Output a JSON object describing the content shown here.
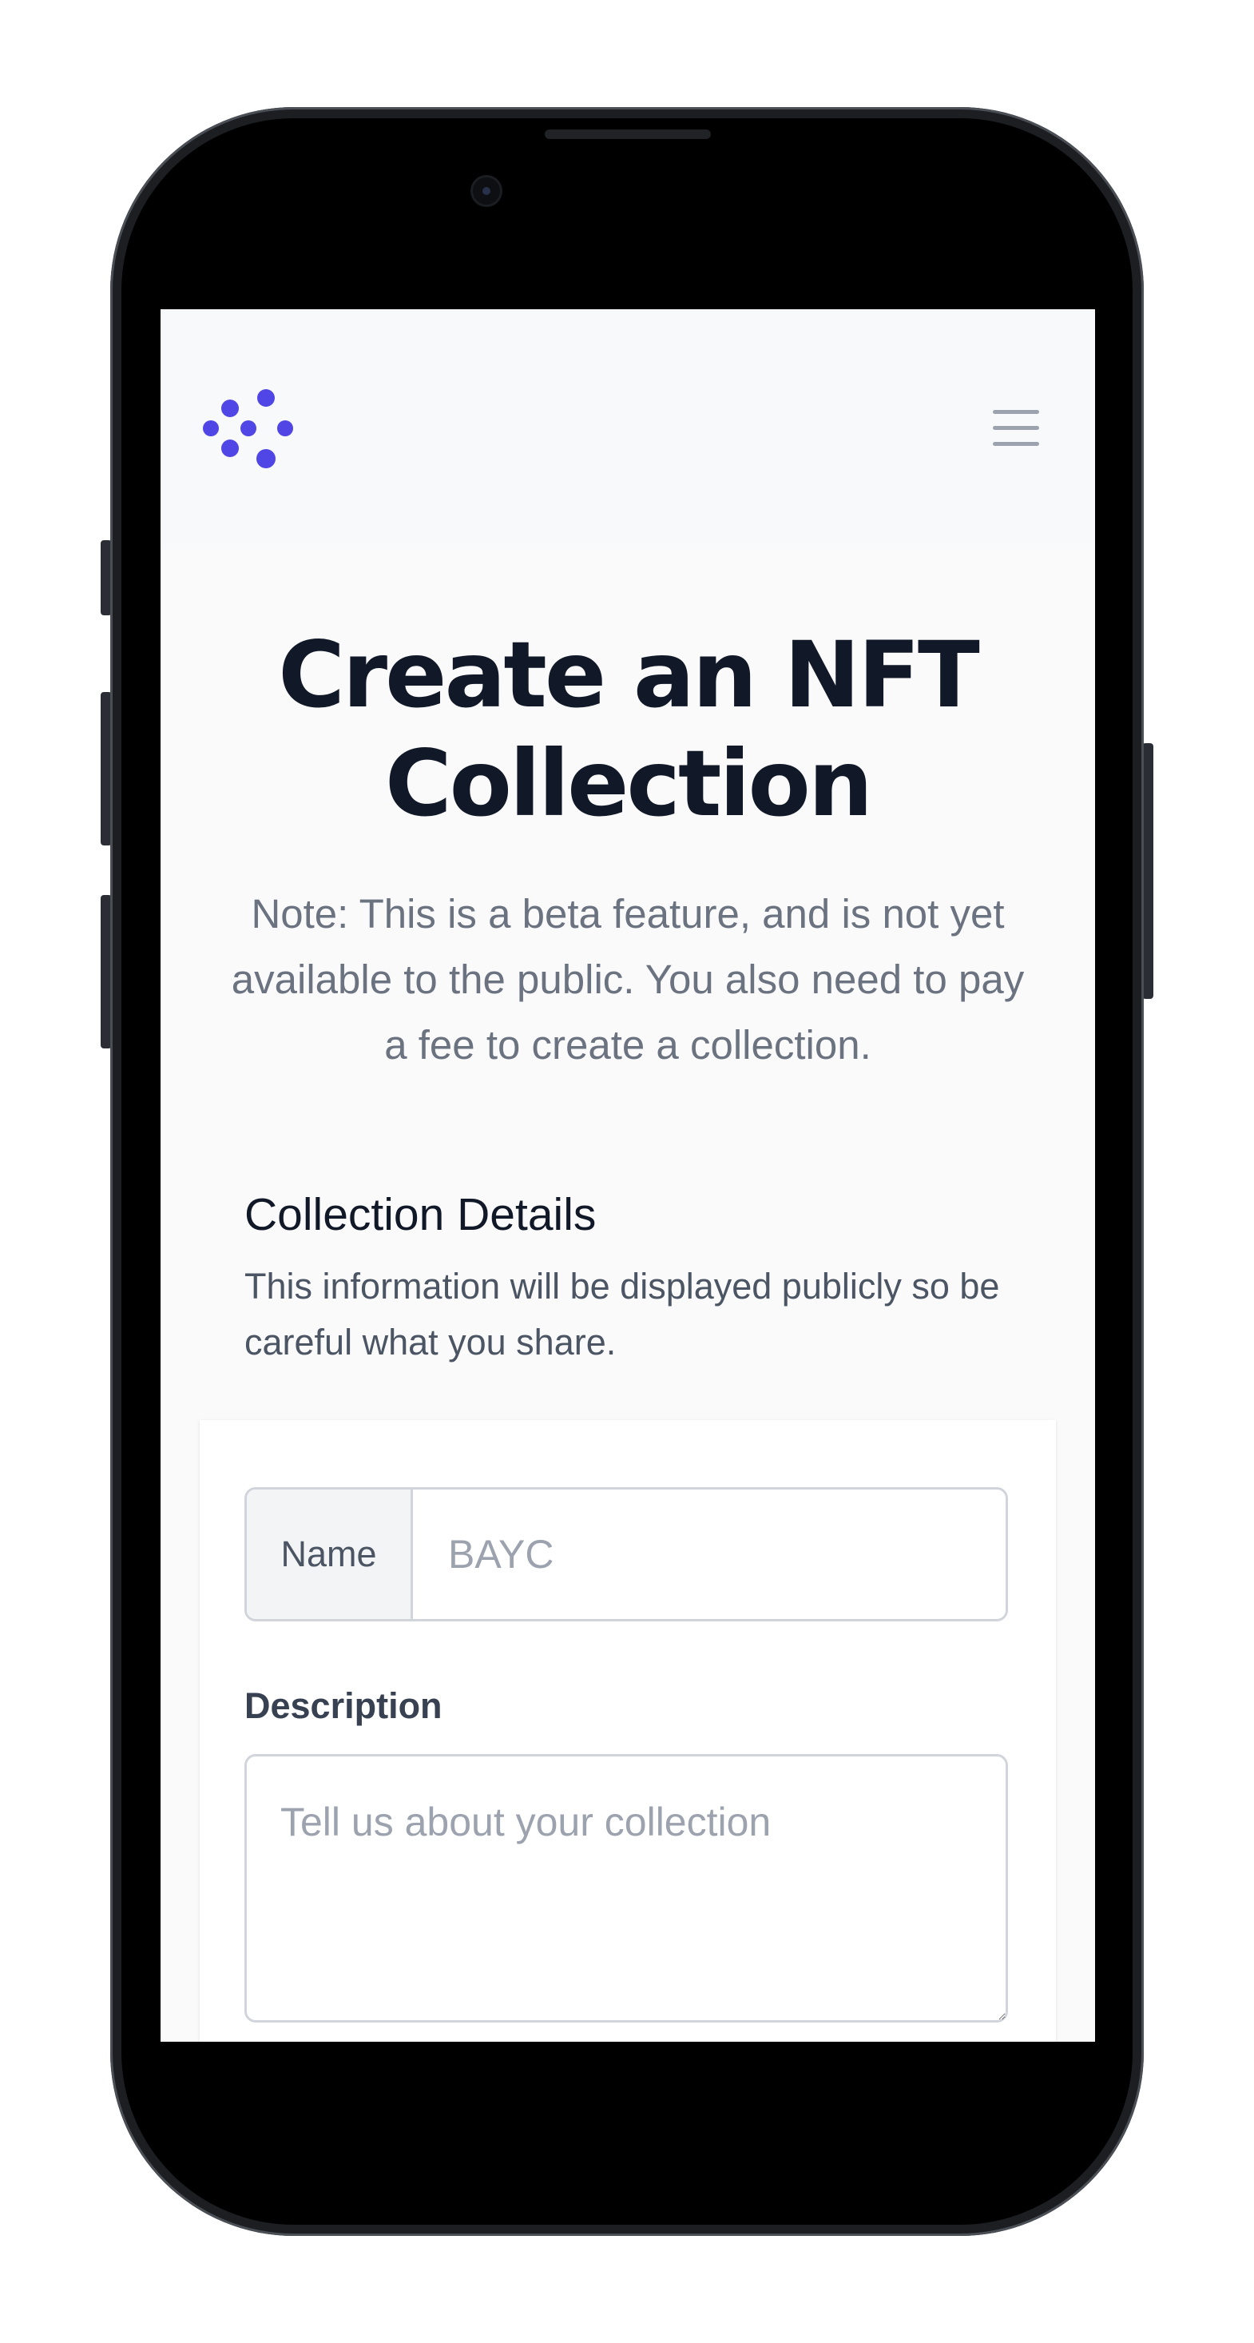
{
  "header": {
    "logo_icon": "brand-dots-logo",
    "menu_icon": "hamburger-menu-icon",
    "brand_color": "#4f46e5"
  },
  "hero": {
    "title": "Create an NFT Collection",
    "note": "Note: This is a beta feature, and is not yet available to the public. You also need to pay a fee to create a collection."
  },
  "section": {
    "title": "Collection Details",
    "description": "This information will be displayed publicly so be careful what you share."
  },
  "form": {
    "name_label": "Name",
    "name_value": "",
    "name_placeholder": "BAYC",
    "description_label": "Description",
    "description_value": "",
    "description_placeholder": "Tell us about your collection"
  }
}
